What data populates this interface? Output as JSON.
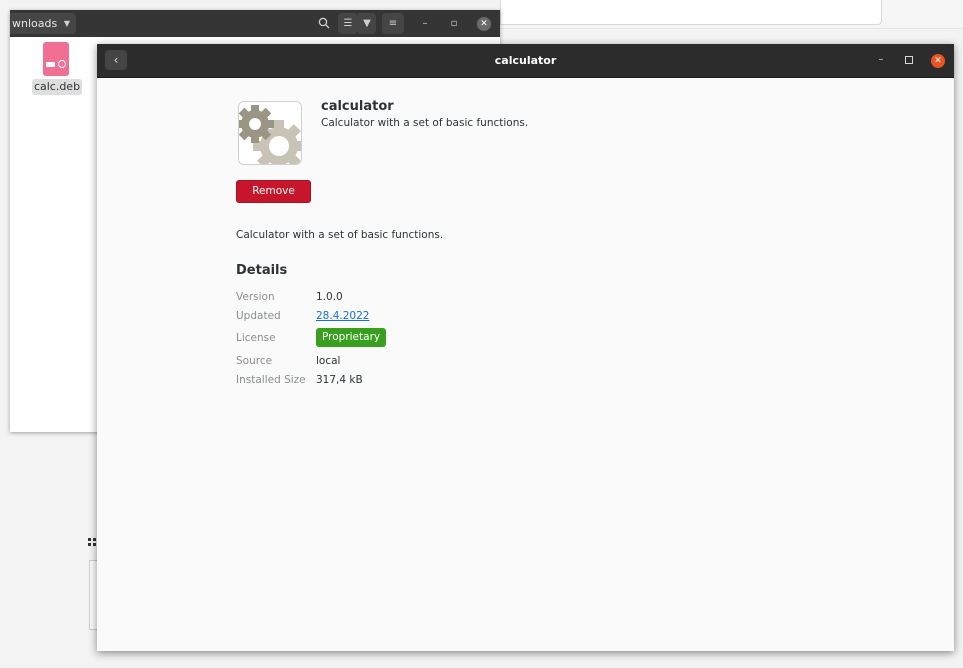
{
  "files_window": {
    "path_label": "wnloads",
    "file": {
      "label": "calc.deb"
    }
  },
  "app_window": {
    "title": "calculator",
    "app_name": "calculator",
    "summary": "Calculator with a set of basic functions.",
    "remove_label": "Remove",
    "description": "Calculator with a set of basic functions.",
    "details_heading": "Details",
    "details": {
      "version": {
        "label": "Version",
        "value": "1.0.0"
      },
      "updated": {
        "label": "Updated",
        "value": "28.4.2022"
      },
      "license": {
        "label": "License",
        "value": "Proprietary"
      },
      "source": {
        "label": "Source",
        "value": "local"
      },
      "installed_size": {
        "label": "Installed Size",
        "value": "317,4 kB"
      }
    }
  },
  "colors": {
    "remove_button": "#c7162b",
    "license_badge": "#38a01e",
    "close_button": "#e95420",
    "header_bar": "#2c2c2c",
    "file_icon": "#f26f94"
  },
  "icons": {
    "app_icon": "gears-icon",
    "back": "chevron-left-icon",
    "file": "package-icon"
  }
}
